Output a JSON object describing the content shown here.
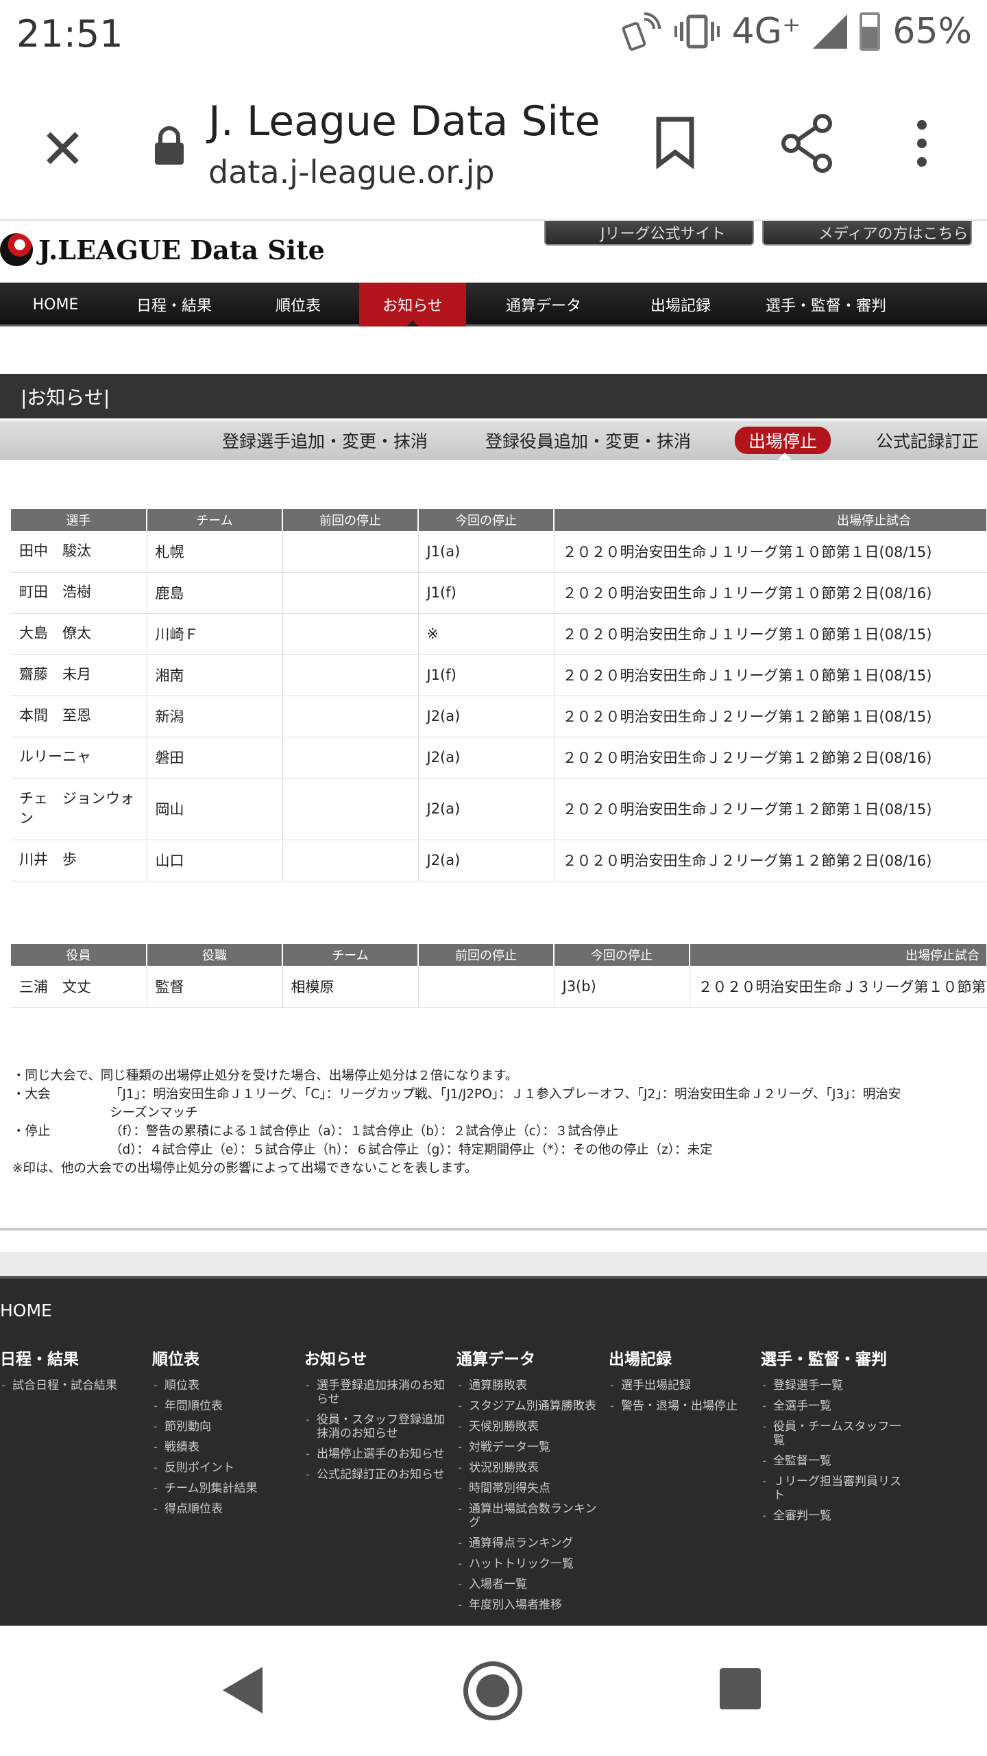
{
  "status_bar": {
    "time": "21:51",
    "network": "4G⁺",
    "battery": "65%"
  },
  "browser": {
    "title": "J. League Data Site",
    "url": "data.j-league.or.jp"
  },
  "site": {
    "logo_text": "J.LEAGUE Data Site",
    "header_buttons": [
      "Jリーグ公式サイト",
      "メディアの方はこちら"
    ]
  },
  "nav": [
    {
      "label": "HOME"
    },
    {
      "label": "日程・結果"
    },
    {
      "label": "順位表"
    },
    {
      "label": "お知らせ",
      "active": true
    },
    {
      "label": "通算データ"
    },
    {
      "label": "出場記録"
    },
    {
      "label": "選手・監督・審判"
    }
  ],
  "page_title": "|お知らせ|",
  "subnav": [
    {
      "label": "登録選手追加・変更・抹消"
    },
    {
      "label": "登録役員追加・変更・抹消"
    },
    {
      "label": "出場停止",
      "active": true
    },
    {
      "label": "公式記録訂正"
    }
  ],
  "players_table": {
    "headers": [
      "選手",
      "チーム",
      "前回の停止",
      "今回の停止",
      "出場停止試合"
    ],
    "rows": [
      [
        "田中　駿汰",
        "札幌",
        "",
        "J1(a)",
        "２０２０明治安田生命Ｊ１リーグ第１０節第１日(08/15)"
      ],
      [
        "町田　浩樹",
        "鹿島",
        "",
        "J1(f)",
        "２０２０明治安田生命Ｊ１リーグ第１０節第２日(08/16)"
      ],
      [
        "大島　僚太",
        "川崎Ｆ",
        "",
        "※",
        "２０２０明治安田生命Ｊ１リーグ第１０節第１日(08/15)"
      ],
      [
        "齋藤　未月",
        "湘南",
        "",
        "J1(f)",
        "２０２０明治安田生命Ｊ１リーグ第１０節第１日(08/15)"
      ],
      [
        "本間　至恩",
        "新潟",
        "",
        "J2(a)",
        "２０２０明治安田生命Ｊ２リーグ第１２節第１日(08/15)"
      ],
      [
        "ルリーニャ",
        "磐田",
        "",
        "J2(a)",
        "２０２０明治安田生命Ｊ２リーグ第１２節第２日(08/16)"
      ],
      [
        "チェ　ジョンウォン",
        "岡山",
        "",
        "J2(a)",
        "２０２０明治安田生命Ｊ２リーグ第１２節第１日(08/15)"
      ],
      [
        "川井　歩",
        "山口",
        "",
        "J2(a)",
        "２０２０明治安田生命Ｊ２リーグ第１２節第２日(08/16)"
      ]
    ]
  },
  "officials_table": {
    "headers": [
      "役員",
      "役職",
      "チーム",
      "前回の停止",
      "今回の停止",
      "出場停止試合"
    ],
    "rows": [
      [
        "三浦　文丈",
        "監督",
        "相模原",
        "",
        "J3(b)",
        "２０２０明治安田生命Ｊ３リーグ第１０節第"
      ]
    ]
  },
  "notes": {
    "line1": "・同じ大会で、同じ種類の出場停止処分を受けた場合、出場停止処分は２倍になります。",
    "taikai_key": "・大会",
    "taikai_val": "「J1」：明治安田生命Ｊ１リーグ、「C」：リーグカップ戦、「J1/J2PO」：Ｊ１参入プレーオフ、「J2」：明治安田生命Ｊ２リーグ、「J3」：明治安",
    "taikai_val2": "シーズンマッチ",
    "teishi_key": "・停止",
    "teishi_val": "（f）：警告の累積による１試合停止（a）：１試合停止（b）：２試合停止（c）：３試合停止",
    "teishi_val2": "（d）：４試合停止（e）：５試合停止（h）：６試合停止（g）：特定期間停止（*）：その他の停止（z）：未定",
    "line_last": "※印は、他の大会での出場停止処分の影響によって出場できないことを表します。"
  },
  "footer": {
    "home": "HOME",
    "columns": [
      {
        "title": "日程・結果",
        "items": [
          "試合日程・試合結果"
        ]
      },
      {
        "title": "順位表",
        "items": [
          "順位表",
          "年間順位表",
          "節別動向",
          "戦績表",
          "反則ポイント",
          "チーム別集計結果",
          "得点順位表"
        ]
      },
      {
        "title": "お知らせ",
        "items": [
          "選手登録追加抹消のお知らせ",
          "役員・スタッフ登録追加抹消のお知らせ",
          "出場停止選手のお知らせ",
          "公式記録訂正のお知らせ"
        ]
      },
      {
        "title": "通算データ",
        "items": [
          "通算勝敗表",
          "スタジアム別通算勝敗表",
          "天候別勝敗表",
          "対戦データ一覧",
          "状況別勝敗表",
          "時間帯別得失点",
          "通算出場試合数ランキング",
          "通算得点ランキング",
          "ハットトリック一覧",
          "入場者一覧",
          "年度別入場者推移"
        ]
      },
      {
        "title": "出場記録",
        "items": [
          "選手出場記録",
          "警告・退場・出場停止"
        ]
      },
      {
        "title": "選手・監督・審判",
        "items": [
          "登録選手一覧",
          "全選手一覧",
          "役員・チームスタッフ一覧",
          "全監督一覧",
          "Ｊリーグ担当審判員リスト",
          "全審判一覧"
        ]
      }
    ]
  }
}
